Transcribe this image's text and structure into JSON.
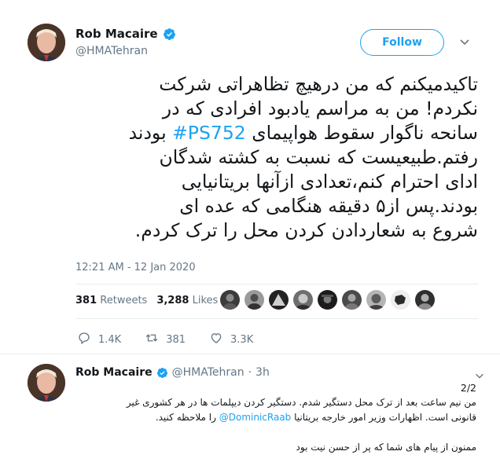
{
  "tweet": {
    "author": {
      "name": "Rob Macaire",
      "handle": "@HMATehran",
      "verified": true
    },
    "follow_label": "Follow",
    "text_lines": [
      "تاکیدمیکنم که من درهیچ تظاهراتی شرکت",
      "نکردم! من به مراسم یادبود افرادی که در",
      "سانحه ناگوار سقوط هواپیمای",
      "رفتم.طبیعیست که نسبت به کشته شدگان",
      "ادای احترام کنم،تعدادی ازآنها بریتانیایی",
      "بودند.پس از۵ دقیقه هنگامی که عده ای",
      "شروع به شعاردادن کردن محل را ترک کردم."
    ],
    "line3_hashtag": "#PS752",
    "line3_suffix": "بودند",
    "timestamp": "12:21 AM - 12 Jan 2020",
    "retweets_count": "381",
    "retweets_label": "Retweets",
    "likes_count": "3,288",
    "likes_label": "Likes",
    "actions": {
      "replies": "1.4K",
      "retweets": "381",
      "likes": "3.3K"
    }
  },
  "reply": {
    "name": "Rob Macaire",
    "handle": "@HMATehran",
    "separator": "·",
    "time": "3h",
    "counter": "2/2",
    "line1": "من نیم ساعت بعد از ترک محل دستگیر شدم. دستگیر کردن دیپلمات ها در هر کشوری غیر",
    "line2": "قانونی است. اظهارات وزیر امور خارجه بریتانیا",
    "mention": "@DominicRaab",
    "line2_end": "را ملاحظه کنید.",
    "line3": "ممنون از پیام های شما که پر از حسن نیت بود"
  },
  "colors": {
    "accent": "#1da1f2",
    "secondary_text": "#657786",
    "divider": "#e6ecf0"
  },
  "icons": [
    "verified-badge-icon",
    "chevron-down-icon",
    "reply-icon",
    "retweet-icon",
    "heart-icon"
  ]
}
